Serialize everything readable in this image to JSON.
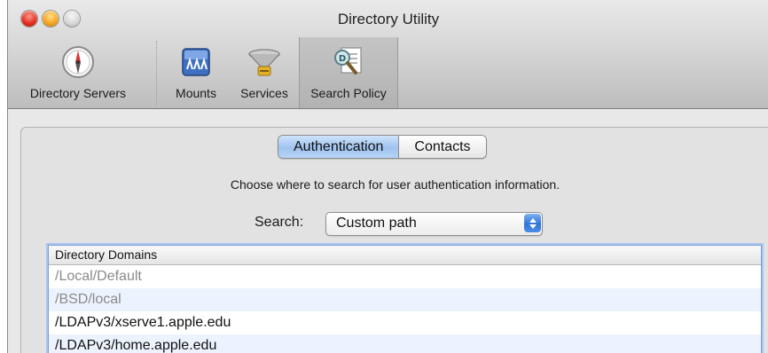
{
  "window": {
    "title": "Directory Utility"
  },
  "toolbar": {
    "items": [
      {
        "label": "Directory Servers",
        "icon": "compass-icon"
      },
      {
        "label": "Mounts",
        "icon": "mounts-icon"
      },
      {
        "label": "Services",
        "icon": "services-icon"
      },
      {
        "label": "Search Policy",
        "icon": "search-policy-icon",
        "selected": true
      }
    ]
  },
  "tabs": [
    {
      "label": "Authentication",
      "selected": true
    },
    {
      "label": "Contacts",
      "selected": false
    }
  ],
  "prompt": "Choose where to search for user authentication information.",
  "search": {
    "label": "Search:",
    "value": "Custom path"
  },
  "domains": {
    "header": "Directory Domains",
    "rows": [
      {
        "path": "/Local/Default",
        "enabled": false
      },
      {
        "path": "/BSD/local",
        "enabled": false
      },
      {
        "path": "/LDAPv3/xserve1.apple.edu",
        "enabled": true
      },
      {
        "path": "/LDAPv3/home.apple.edu",
        "enabled": true
      }
    ]
  },
  "colors": {
    "accent": "#3b82e0",
    "row_alt": "#edf3fe"
  }
}
